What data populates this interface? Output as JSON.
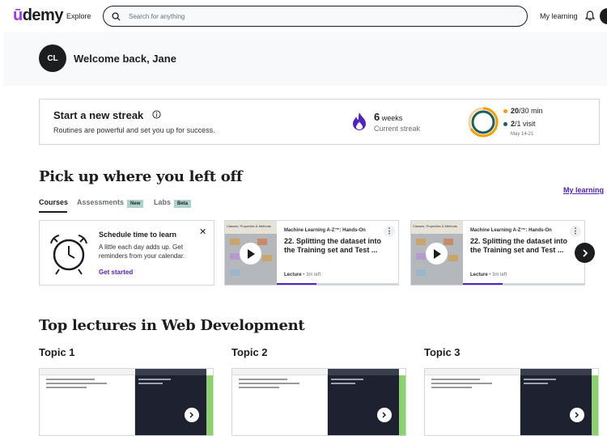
{
  "header": {
    "logo": "Udemy",
    "explore": "Explore",
    "search_placeholder": "Search for anything",
    "my_learning": "My learning"
  },
  "welcome": {
    "initials": "CL",
    "text": "Welcome back, Jane"
  },
  "streak": {
    "title": "Start a new streak",
    "subtitle": "Routines are powerful and set you up for success.",
    "weeks_value": "6",
    "weeks_unit": "weeks",
    "current_label": "Current streak",
    "minutes_done": "20",
    "minutes_goal": "/30 min",
    "visits_done": "2",
    "visits_goal": "/1 visit",
    "date_range": "May 14-21",
    "colors": {
      "minutes": "#f69c08",
      "visits": "#1e6055",
      "flame": "#5022c3"
    },
    "minutes_progress": 0.67,
    "visits_progress": 1.0
  },
  "pickup": {
    "heading": "Pick up where you left off",
    "my_learning_link": "My learning",
    "tabs": [
      {
        "label": "Courses",
        "badge": ""
      },
      {
        "label": "Assessments",
        "badge": "New"
      },
      {
        "label": "Labs",
        "badge": "Beta"
      }
    ],
    "schedule": {
      "title": "Schedule time to learn",
      "description": "A little each day adds up. Get reminders from your calendar.",
      "link": "Get started"
    },
    "courses": [
      {
        "thumb_caption": "Classes, Properties & Methods",
        "category": "Machine Learning A-Z™: Hands-On",
        "title": "22. Splitting the dataset into the Training set and Test ...",
        "type": "Lecture",
        "remaining": "3m left",
        "progress": 0.32
      },
      {
        "thumb_caption": "Classes, Properties & Methods",
        "category": "Machine Learning A-Z™: Hands-On",
        "title": "22. Splitting the dataset into the Training set and Test ...",
        "type": "Lecture",
        "remaining": "3m left",
        "progress": 0.32
      }
    ]
  },
  "top_lectures": {
    "heading": "Top lectures in Web Development",
    "topics": [
      "Topic 1",
      "Topic 2",
      "Topic 3"
    ]
  }
}
